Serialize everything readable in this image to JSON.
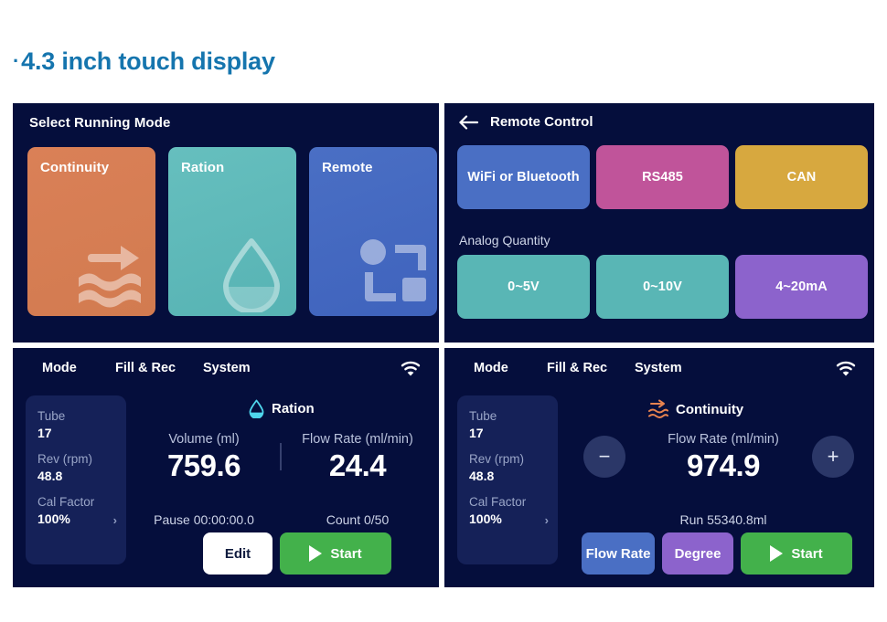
{
  "heading": {
    "bullet": "·",
    "text": "4.3 inch touch display"
  },
  "colors": {
    "panel_bg": "#050e3c",
    "heading_blue": "#1575ae",
    "continuity_orange": "#d27b50",
    "ration_teal": "#57b3b4",
    "remote_blue": "#4a6fc4",
    "rs485_pink": "#c0549a",
    "can_gold": "#d7a83f",
    "analog_teal": "#59b6b5",
    "ma_purple": "#8c63cc",
    "start_green": "#43b14b",
    "sidecard_bg": "#152158"
  },
  "select_mode_screen": {
    "title": "Select Running Mode",
    "cards": [
      {
        "label": "Continuity",
        "icon": "flow-arrow-waves-icon"
      },
      {
        "label": "Ration",
        "icon": "water-droplet-icon"
      },
      {
        "label": "Remote",
        "icon": "remote-nodes-icon"
      }
    ]
  },
  "remote_control_screen": {
    "back_icon": "back-arrow-icon",
    "title": "Remote Control",
    "protocol_buttons": [
      {
        "label": "WiFi or Bluetooth"
      },
      {
        "label": "RS485"
      },
      {
        "label": "CAN"
      }
    ],
    "analog_section_label": "Analog Quantity",
    "analog_buttons": [
      {
        "label": "0~5V"
      },
      {
        "label": "0~10V"
      },
      {
        "label": "4~20mA"
      }
    ]
  },
  "ration_run_screen": {
    "topbar": {
      "items": [
        "Mode",
        "Fill & Rec",
        "System"
      ],
      "wifi_icon": "wifi-icon"
    },
    "sidecard": [
      {
        "key": "Tube",
        "value": "17"
      },
      {
        "key": "Rev (rpm)",
        "value": "48.8"
      },
      {
        "key": "Cal Factor",
        "value": "100%",
        "chevron": "›"
      }
    ],
    "mode_tag": {
      "label": "Ration",
      "icon": "water-droplet-icon"
    },
    "readouts": [
      {
        "key": "Volume (ml)",
        "value": "759.6"
      },
      {
        "key": "Flow Rate (ml/min)",
        "value": "24.4"
      }
    ],
    "sub_values": [
      "Pause 00:00:00.0",
      "Count 0/50"
    ],
    "buttons": [
      {
        "label": "Edit",
        "style": "white"
      },
      {
        "label": "Start",
        "style": "green",
        "icon": "play-icon"
      }
    ]
  },
  "continuity_run_screen": {
    "topbar": {
      "items": [
        "Mode",
        "Fill & Rec",
        "System"
      ],
      "wifi_icon": "wifi-icon"
    },
    "sidecard": [
      {
        "key": "Tube",
        "value": "17"
      },
      {
        "key": "Rev (rpm)",
        "value": "48.8"
      },
      {
        "key": "Cal Factor",
        "value": "100%",
        "chevron": "›"
      }
    ],
    "mode_tag": {
      "label": "Continuity",
      "icon": "flow-arrow-waves-icon"
    },
    "stepper": {
      "minus": "−",
      "plus": "+"
    },
    "readout": {
      "key": "Flow Rate (ml/min)",
      "value": "974.9"
    },
    "sub_value": "Run  55340.8ml",
    "buttons": [
      {
        "label": "Flow Rate",
        "style": "blue"
      },
      {
        "label": "Degree",
        "style": "purple"
      },
      {
        "label": "Start",
        "style": "green",
        "icon": "play-icon"
      }
    ]
  }
}
